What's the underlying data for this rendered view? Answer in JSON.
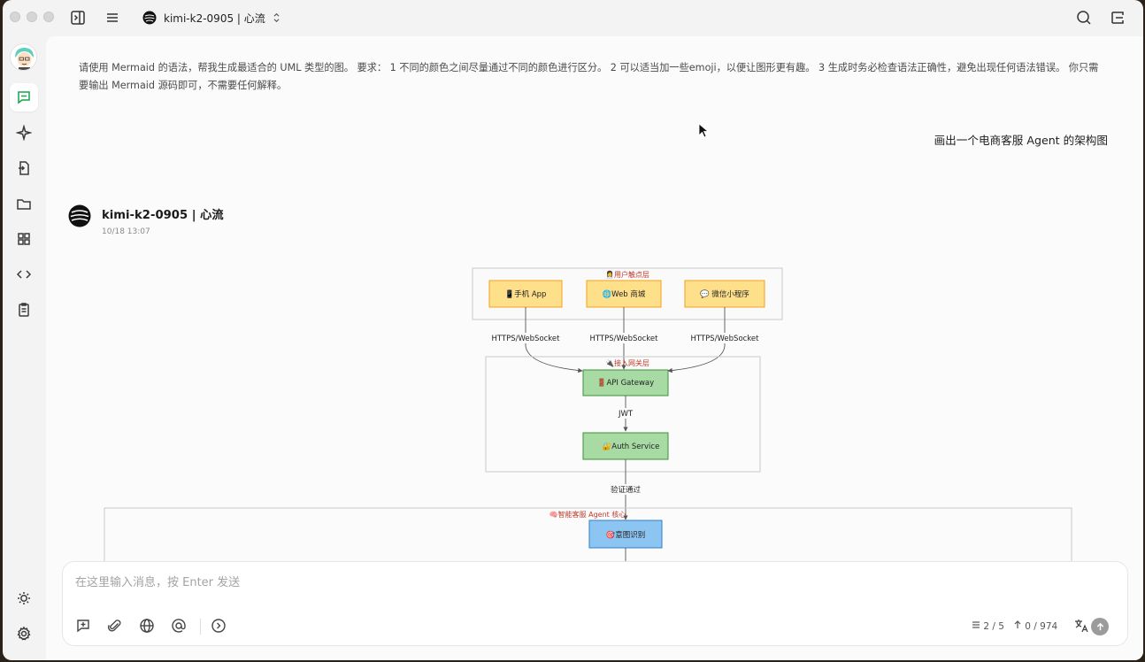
{
  "titlebar": {
    "model_title": "kimi-k2-0905 | 心流"
  },
  "sidebar": {
    "items": [
      {
        "name": "chat",
        "icon": "chat-bubble-icon",
        "active": true
      },
      {
        "name": "agents",
        "icon": "sparkle-icon",
        "active": false
      },
      {
        "name": "files",
        "icon": "file-swap-icon",
        "active": false
      },
      {
        "name": "folders",
        "icon": "folder-icon",
        "active": false
      },
      {
        "name": "apps",
        "icon": "grid-icon",
        "active": false
      },
      {
        "name": "code",
        "icon": "code-icon",
        "active": false
      },
      {
        "name": "notes",
        "icon": "clipboard-icon",
        "active": false
      }
    ],
    "bottom": [
      {
        "name": "theme",
        "icon": "sun-icon"
      },
      {
        "name": "settings",
        "icon": "gear-icon"
      }
    ]
  },
  "conversation": {
    "system_prompt": "请使用 Mermaid 的语法，帮我生成最适合的 UML 类型的图。 要求： 1 不同的颜色之间尽量通过不同的颜色进行区分。 2 可以适当加一些emoji，以便让图形更有趣。 3 生成时务必检查语法正确性，避免出现任何语法错误。 你只需要输出 Mermaid 源码即可，不需要任何解释。",
    "user_message": "画出一个电商客服 Agent 的架构图",
    "assistant": {
      "name": "kimi-k2-0905 | 心流",
      "time": "10/18 13:07"
    }
  },
  "diagram": {
    "groups": {
      "user_layer": "👩‍💼用户触点层",
      "gateway_layer": "🔌接入网关层",
      "agent_core": "🧠智能客服 Agent 核心"
    },
    "nodes": {
      "mobile_app": "📱手机 App",
      "web_store": "🌐Web 商城",
      "wechat_mini": "💬 微信小程序",
      "api_gateway": "🚪API Gateway",
      "auth_service": "🔐Auth Service",
      "intent": "🎯意图识别"
    },
    "edges": {
      "https1": "HTTPS/WebSocket",
      "https2": "HTTPS/WebSocket",
      "https3": "HTTPS/WebSocket",
      "jwt": "JWT",
      "verified": "验证通过"
    },
    "colors": {
      "user_node_fill": "#ffe08a",
      "user_node_stroke": "#f0a020",
      "gateway_node_fill": "#a8dba4",
      "gateway_node_stroke": "#3f8f3a",
      "agent_node_fill": "#8cc4f2",
      "agent_node_stroke": "#2f7fc9",
      "group_label": "#c0392b"
    }
  },
  "composer": {
    "placeholder": "在这里输入消息，按 Enter 发送",
    "page_indicator": "2 / 5",
    "token_count": "0 / 974"
  }
}
